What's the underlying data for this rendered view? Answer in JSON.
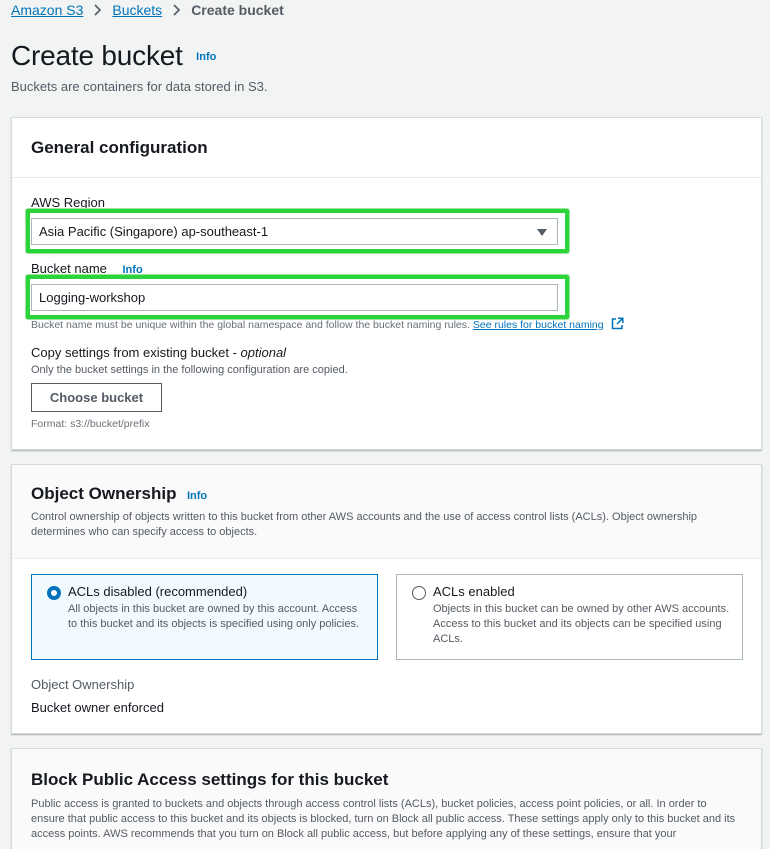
{
  "breadcrumb": {
    "items": [
      "Amazon S3",
      "Buckets"
    ],
    "current": "Create bucket"
  },
  "page": {
    "title": "Create bucket",
    "info": "Info",
    "description": "Buckets are containers for data stored in S3."
  },
  "general": {
    "title": "General configuration",
    "region_label": "AWS Region",
    "region_value": "Asia Pacific (Singapore) ap-southeast-1",
    "bucket_name_label": "Bucket name",
    "bucket_name_info": "Info",
    "bucket_name_value": "Logging-workshop",
    "bucket_name_hint": "Bucket name must be unique within the global namespace and follow the bucket naming rules.",
    "naming_rules_link": "See rules for bucket naming",
    "copy_label": "Copy settings from existing bucket - ",
    "copy_label_optional": "optional",
    "copy_hint": "Only the bucket settings in the following configuration are copied.",
    "choose_button": "Choose bucket",
    "format_hint": "Format: s3://bucket/prefix"
  },
  "ownership": {
    "title": "Object Ownership",
    "info": "Info",
    "description": "Control ownership of objects written to this bucket from other AWS accounts and the use of access control lists (ACLs). Object ownership determines who can specify access to objects.",
    "options": [
      {
        "title": "ACLs disabled (recommended)",
        "description": "All objects in this bucket are owned by this account. Access to this bucket and its objects is specified using only policies.",
        "selected": true
      },
      {
        "title": "ACLs enabled",
        "description": "Objects in this bucket can be owned by other AWS accounts. Access to this bucket and its objects can be specified using ACLs.",
        "selected": false
      }
    ],
    "status_label": "Object Ownership",
    "status_value": "Bucket owner enforced"
  },
  "bpa": {
    "title": "Block Public Access settings for this bucket",
    "description": "Public access is granted to buckets and objects through access control lists (ACLs), bucket policies, access point policies, or all. In order to ensure that public access to this bucket and its objects is blocked, turn on Block all public access. These settings apply only to this bucket and its access points. AWS recommends that you turn on Block all public access, but before applying any of these settings, ensure that your"
  },
  "colors": {
    "link": "#0073bb",
    "highlight": "#2bd43a",
    "selected_tile_bg": "#f1faff"
  }
}
